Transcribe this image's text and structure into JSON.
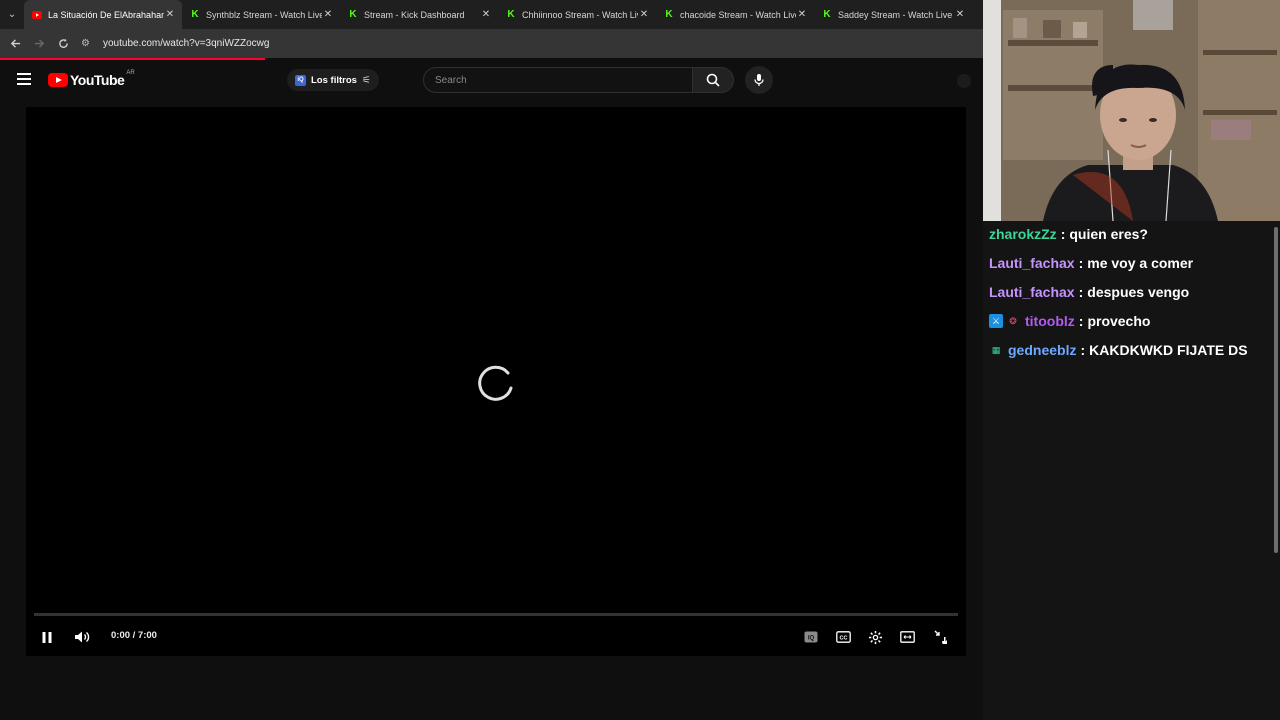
{
  "browser": {
    "tabs": [
      {
        "title": "La Situación De ElAbrahaham E",
        "favicon": "youtube-icon",
        "active": true
      },
      {
        "title": "Synthblz Stream - Watch Live o",
        "favicon": "kick-icon",
        "active": false
      },
      {
        "title": "Stream - Kick Dashboard",
        "favicon": "kick-icon",
        "active": false
      },
      {
        "title": "Chhiinnoo Stream - Watch Live",
        "favicon": "kick-icon",
        "active": false
      },
      {
        "title": "chacoide Stream - Watch Live o",
        "favicon": "kick-icon",
        "active": false
      },
      {
        "title": "Saddey Stream - Watch Live on",
        "favicon": "kick-icon",
        "active": false
      }
    ],
    "url": "youtube.com/watch?v=3qniWZZocwg",
    "load_progress": 0.27
  },
  "masthead": {
    "logo_text": "YouTube",
    "region": "AR",
    "filters_label": "Los filtros",
    "filters_badge": "iQ",
    "search_placeholder": "Search"
  },
  "player": {
    "state": "buffering",
    "time_display": "0:00 / 7:00",
    "current_seconds": 0,
    "duration_seconds": 420,
    "controls_right": [
      "iq-icon",
      "captions-icon",
      "settings-icon",
      "theater-mode-icon",
      "fullscreen-exit-icon"
    ]
  },
  "chat": {
    "messages": [
      {
        "user": "zharokzZz",
        "text": "quien eres?",
        "color": "#3fd39a",
        "badges": []
      },
      {
        "user": "Lauti_fachax",
        "text": "me voy a comer",
        "color": "#c594ff",
        "badges": []
      },
      {
        "user": "Lauti_fachax",
        "text": "despues vengo",
        "color": "#c594ff",
        "badges": []
      },
      {
        "user": "titooblz",
        "text": "provecho",
        "color": "#b05cf0",
        "badges": [
          "sword-badge-icon",
          "gem-badge-icon"
        ]
      },
      {
        "user": "gedneeblz",
        "text": "KAKDKWKD FIJATE DS",
        "color": "#6ea8ff",
        "badges": [
          "gift-badge-icon"
        ]
      }
    ]
  },
  "colors": {
    "youtube_red": "#ff0000",
    "kick_green": "#53fc18",
    "progress_red": "#ff0033"
  }
}
